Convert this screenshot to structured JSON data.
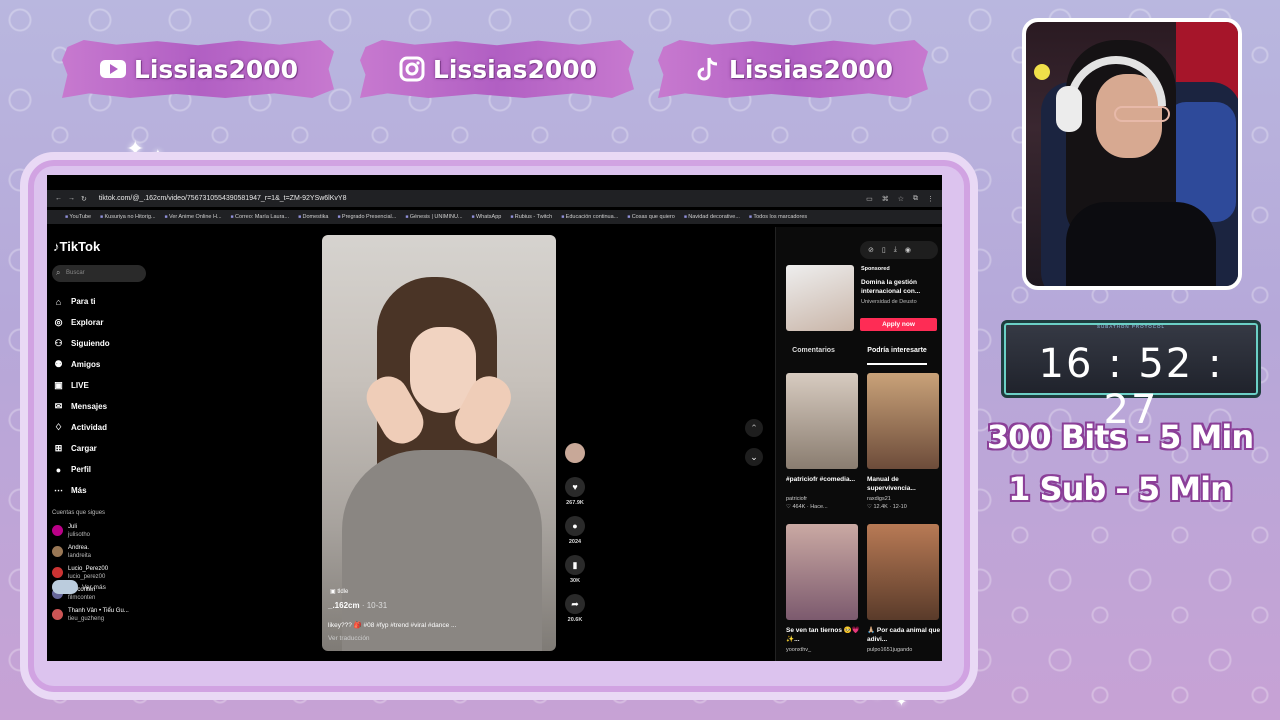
{
  "socials": [
    {
      "icon": "youtube-icon",
      "handle": "Lissias2000"
    },
    {
      "icon": "instagram-icon",
      "handle": "Lissias2000"
    },
    {
      "icon": "tiktok-icon",
      "handle": "Lissias2000"
    }
  ],
  "browser": {
    "url": "tiktok.com/@_.162cm/video/7567310554390581947_r=1&_t=ZM-92YSw6lKvY8",
    "bookmarks": [
      "YouTube",
      "Kusuriya no Hitorig...",
      "Ver Anime Online H...",
      "Correo: María Laura...",
      "Domestika",
      "Pregrado Presencial...",
      "Génesis | UNIMINU...",
      "WhatsApp",
      "Rubius - Twitch",
      "Educación continua...",
      "Cosas que quiero",
      "Navidad decorative...",
      "Todos los marcadores"
    ]
  },
  "tiktok": {
    "logo": "TikTok",
    "search_placeholder": "Buscar",
    "nav": [
      {
        "icon": "home-icon",
        "label": "Para ti"
      },
      {
        "icon": "compass-icon",
        "label": "Explorar"
      },
      {
        "icon": "following-icon",
        "label": "Siguiendo"
      },
      {
        "icon": "friends-icon",
        "label": "Amigos"
      },
      {
        "icon": "live-icon",
        "label": "LIVE"
      },
      {
        "icon": "messages-icon",
        "label": "Mensajes"
      },
      {
        "icon": "activity-icon",
        "label": "Actividad"
      },
      {
        "icon": "upload-icon",
        "label": "Cargar"
      },
      {
        "icon": "profile-icon",
        "label": "Perfil"
      },
      {
        "icon": "more-icon",
        "label": "Más"
      }
    ],
    "following_header": "Cuentas que sigues",
    "accounts": [
      {
        "name": "Juli",
        "handle": "julisotho"
      },
      {
        "name": "Andrea.",
        "handle": "landreita"
      },
      {
        "name": "Lucio_Perez00",
        "handle": "lucio_perez00"
      },
      {
        "name": "filmconten",
        "handle": "filmconten"
      },
      {
        "name": "Thanh Vân • Tiểu Gu...",
        "handle": "tieu_guzheng"
      }
    ],
    "see_more": "Ver más",
    "video": {
      "music": "tldle",
      "author": "_.162cm",
      "date": "· 10-31",
      "caption": "likey??? 🎒 #08 #fyp #trend #viral #dance ...",
      "translate": "Ver traducción"
    },
    "actions": [
      {
        "icon": "heart-icon",
        "count": "267.9K"
      },
      {
        "icon": "comment-icon",
        "count": "2024"
      },
      {
        "icon": "bookmark-icon",
        "count": "30K"
      },
      {
        "icon": "share-icon",
        "count": "20.6K"
      }
    ],
    "ad": {
      "sponsored": "Sponsored",
      "title": "Domina la gestión internacional con...",
      "advertiser": "Universidad de Deusto",
      "cta": "Apply now"
    },
    "tabs": [
      "Comentarios",
      "Podría interesarte"
    ],
    "suggestions": [
      {
        "caption": "#patriciofr #comedia...",
        "author": "patriciofr",
        "meta": "♡ 464K · Hace..."
      },
      {
        "caption": "Manual de supervivencia...",
        "author": "raxdigs21",
        "meta": "♡ 12.4K · 12-10"
      },
      {
        "caption": "Se ven tan tiernos 🥺💗✨...",
        "author": "yoonxthv_",
        "meta": ""
      },
      {
        "caption": "🙏🏼 Por cada animal que adivi...",
        "author": "pulpo1651jugando",
        "meta": ""
      }
    ]
  },
  "stream": {
    "timer_header": "SUBATHON PROTOCOL",
    "timer": "16 : 52 : 27",
    "goal_bits": "300 Bits - 5 Min",
    "goal_sub": "1 Sub - 5 Min"
  }
}
